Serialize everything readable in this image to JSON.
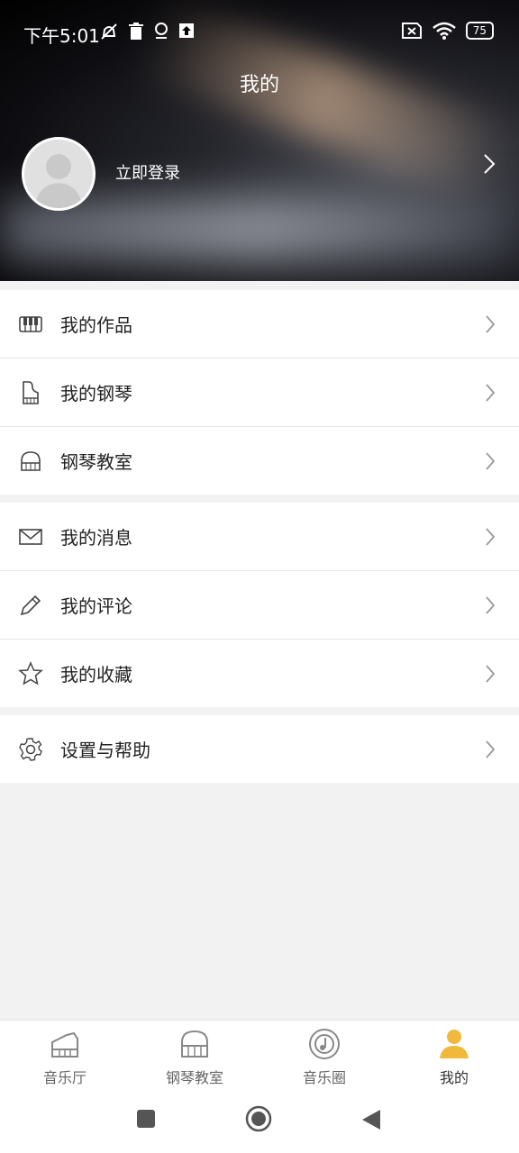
{
  "status": {
    "time": "下午5:01",
    "battery": "75"
  },
  "header": {
    "title": "我的"
  },
  "profile": {
    "login_label": "立即登录"
  },
  "menu": {
    "group1": [
      {
        "label": "我的作品",
        "icon": "piano-keys-icon"
      },
      {
        "label": "我的钢琴",
        "icon": "upright-piano-icon"
      },
      {
        "label": "钢琴教室",
        "icon": "grand-piano-icon"
      }
    ],
    "group2": [
      {
        "label": "我的消息",
        "icon": "mail-icon"
      },
      {
        "label": "我的评论",
        "icon": "pencil-icon"
      },
      {
        "label": "我的收藏",
        "icon": "star-icon"
      }
    ],
    "group3": [
      {
        "label": "设置与帮助",
        "icon": "gear-icon"
      }
    ]
  },
  "tabbar": [
    {
      "label": "音乐厅",
      "icon": "piano-icon",
      "active": false
    },
    {
      "label": "钢琴教室",
      "icon": "grand-piano-icon",
      "active": false
    },
    {
      "label": "音乐圈",
      "icon": "music-disc-icon",
      "active": false
    },
    {
      "label": "我的",
      "icon": "person-icon",
      "active": true
    }
  ],
  "colors": {
    "accent": "#f0b93b",
    "text": "#222222",
    "divider": "#e6e6e6"
  }
}
